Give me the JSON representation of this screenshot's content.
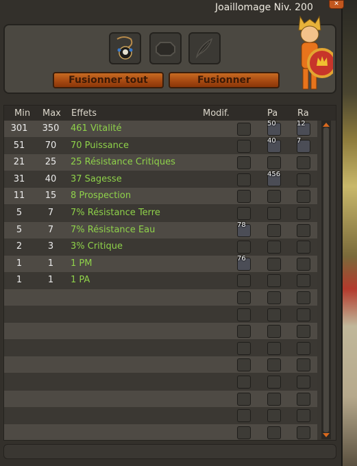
{
  "window": {
    "title": "Joaillomage Niv. 200"
  },
  "buttons": {
    "merge_all": "Fusionner tout",
    "merge": "Fusionner"
  },
  "table": {
    "headers": {
      "min": "Min",
      "max": "Max",
      "effects": "Effets",
      "modif": "Modif.",
      "pa": "Pa",
      "ra": "Ra"
    },
    "rows": [
      {
        "min": "301",
        "max": "350",
        "effect": "461 Vitalité",
        "modif": "",
        "pa": "50",
        "ra": "12"
      },
      {
        "min": "51",
        "max": "70",
        "effect": "70 Puissance",
        "modif": "",
        "pa": "40",
        "ra": "7"
      },
      {
        "min": "21",
        "max": "25",
        "effect": "25 Résistance Critiques",
        "modif": "",
        "pa": "",
        "ra": ""
      },
      {
        "min": "31",
        "max": "40",
        "effect": "37 Sagesse",
        "modif": "",
        "pa": "456",
        "ra": ""
      },
      {
        "min": "11",
        "max": "15",
        "effect": "8 Prospection",
        "modif": "",
        "pa": "",
        "ra": ""
      },
      {
        "min": "5",
        "max": "7",
        "effect": "7% Résistance Terre",
        "modif": "",
        "pa": "",
        "ra": ""
      },
      {
        "min": "5",
        "max": "7",
        "effect": "7% Résistance Eau",
        "modif": "78",
        "pa": "",
        "ra": ""
      },
      {
        "min": "2",
        "max": "3",
        "effect": "3% Critique",
        "modif": "",
        "pa": "",
        "ra": ""
      },
      {
        "min": "1",
        "max": "1",
        "effect": "1 PM",
        "modif": "76",
        "pa": "",
        "ra": ""
      },
      {
        "min": "1",
        "max": "1",
        "effect": "1 PA",
        "modif": "",
        "pa": "",
        "ra": ""
      }
    ]
  },
  "colors": {
    "accent": "#c76a22",
    "effect_text": "#8fd24a"
  }
}
